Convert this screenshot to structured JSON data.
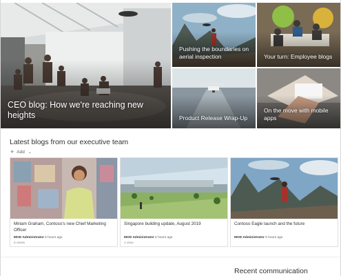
{
  "hero": {
    "main": {
      "caption": "CEO blog: How we're reaching new heights"
    },
    "tiles": [
      {
        "caption": "Pushing the boundaries on aerial inspection"
      },
      {
        "caption": "Your turn: Employee blogs"
      },
      {
        "caption": "Product Release Wrap-Up"
      },
      {
        "caption": "On the move with mobile apps"
      }
    ]
  },
  "news": {
    "heading": "Latest blogs from our executive team",
    "add_label": "Add",
    "cards": [
      {
        "title": "Miriam Graham, Contoso's new Chief Marketing Officer",
        "author": "MOD Administrator",
        "time": "5 hours ago",
        "views": "5 views"
      },
      {
        "title": "Singapore building update, August 2019",
        "author": "MOD Administrator",
        "time": "5 hours ago",
        "views": "1 view"
      },
      {
        "title": "Contoso Eagle launch and the future",
        "author": "MOD Administrator",
        "time": "5 hours ago",
        "views": ""
      }
    ]
  },
  "recent": {
    "heading": "Recent communication"
  },
  "colors": {
    "text": "#323130",
    "subtle": "#605e5c",
    "border": "#e1dfdd"
  }
}
